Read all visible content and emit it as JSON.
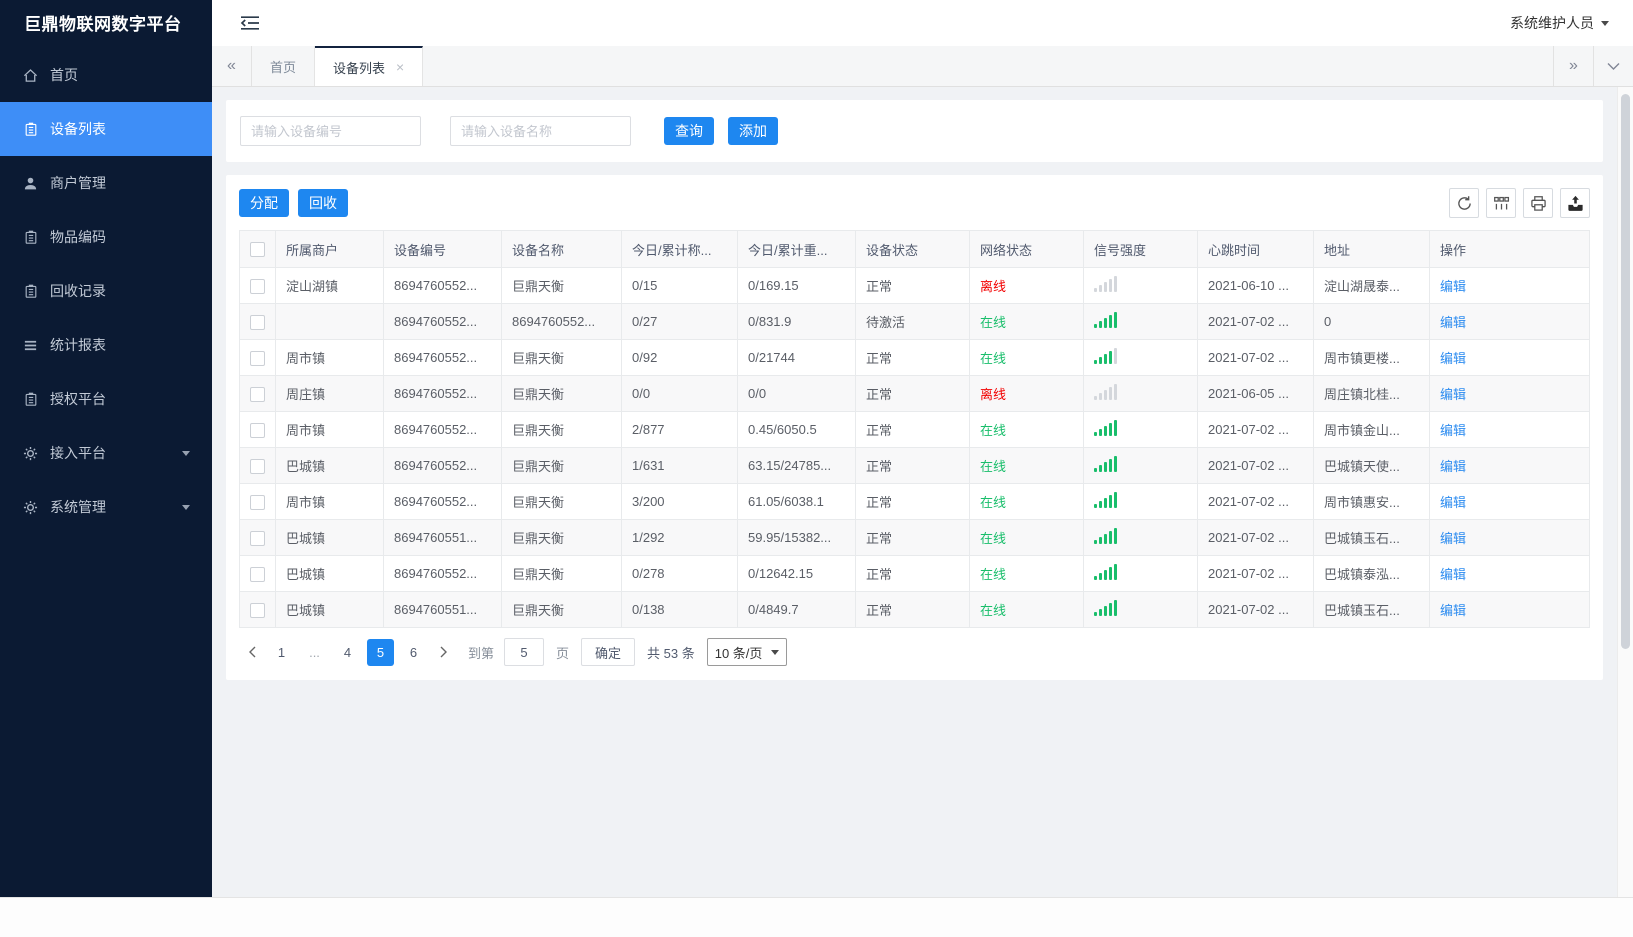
{
  "app": {
    "title": "巨鼎物联网数字平台",
    "user": "系统维护人员"
  },
  "colors": {
    "sidebar_bg": "#0B1A33",
    "sidebar_active": "#3E8EF7",
    "accent": "#1E87F0",
    "success": "#19be6b",
    "danger": "#f20000",
    "link": "#2d8cf0"
  },
  "sidebar": {
    "items": [
      {
        "label": "首页",
        "icon": "home",
        "active": false,
        "arrow": false
      },
      {
        "label": "设备列表",
        "icon": "clipboard",
        "active": true,
        "arrow": false
      },
      {
        "label": "商户管理",
        "icon": "user",
        "active": false,
        "arrow": false
      },
      {
        "label": "物品编码",
        "icon": "clipboard",
        "active": false,
        "arrow": false
      },
      {
        "label": "回收记录",
        "icon": "clipboard",
        "active": false,
        "arrow": false
      },
      {
        "label": "统计报表",
        "icon": "list",
        "active": false,
        "arrow": false
      },
      {
        "label": "授权平台",
        "icon": "clipboard",
        "active": false,
        "arrow": false
      },
      {
        "label": "接入平台",
        "icon": "gear",
        "active": false,
        "arrow": true
      },
      {
        "label": "系统管理",
        "icon": "gear",
        "active": false,
        "arrow": true
      }
    ]
  },
  "tabs": {
    "items": [
      {
        "label": "首页",
        "active": false,
        "closable": false
      },
      {
        "label": "设备列表",
        "active": true,
        "closable": true
      }
    ]
  },
  "search": {
    "device_no_placeholder": "请输入设备编号",
    "device_name_placeholder": "请输入设备名称",
    "query_label": "查询",
    "add_label": "添加"
  },
  "toolbar": {
    "assign_label": "分配",
    "recycle_label": "回收",
    "tools": [
      {
        "icon": "refresh"
      },
      {
        "icon": "columns"
      },
      {
        "icon": "printer"
      },
      {
        "icon": "export"
      }
    ]
  },
  "table": {
    "edit_label": "编辑",
    "columns": [
      {
        "label": "所属商户"
      },
      {
        "label": "设备编号"
      },
      {
        "label": "设备名称"
      },
      {
        "label": "今日/累计称..."
      },
      {
        "label": "今日/累计重..."
      },
      {
        "label": "设备状态"
      },
      {
        "label": "网络状态"
      },
      {
        "label": "信号强度"
      },
      {
        "label": "心跳时间"
      },
      {
        "label": "地址"
      },
      {
        "label": "操作"
      }
    ],
    "rows": [
      {
        "merchant": "淀山湖镇",
        "device_no": "8694760552...",
        "device_name": "巨鼎天衡",
        "today_count": "0/15",
        "today_weight": "0/169.15",
        "device_status": "正常",
        "network_status": "离线",
        "online": false,
        "signal": 0,
        "heartbeat": "2021-06-10 ...",
        "address": "淀山湖晟泰..."
      },
      {
        "merchant": "",
        "device_no": "8694760552...",
        "device_name": "8694760552...",
        "today_count": "0/27",
        "today_weight": "0/831.9",
        "device_status": "待激活",
        "network_status": "在线",
        "online": true,
        "signal": 5,
        "heartbeat": "2021-07-02 ...",
        "address": "0"
      },
      {
        "merchant": "周市镇",
        "device_no": "8694760552...",
        "device_name": "巨鼎天衡",
        "today_count": "0/92",
        "today_weight": "0/21744",
        "device_status": "正常",
        "network_status": "在线",
        "online": true,
        "signal": 4,
        "heartbeat": "2021-07-02 ...",
        "address": "周市镇更楼..."
      },
      {
        "merchant": "周庄镇",
        "device_no": "8694760552...",
        "device_name": "巨鼎天衡",
        "today_count": "0/0",
        "today_weight": "0/0",
        "device_status": "正常",
        "network_status": "离线",
        "online": false,
        "signal": 0,
        "heartbeat": "2021-06-05 ...",
        "address": "周庄镇北桂..."
      },
      {
        "merchant": "周市镇",
        "device_no": "8694760552...",
        "device_name": "巨鼎天衡",
        "today_count": "2/877",
        "today_weight": "0.45/6050.5",
        "device_status": "正常",
        "network_status": "在线",
        "online": true,
        "signal": 5,
        "heartbeat": "2021-07-02 ...",
        "address": "周市镇金山..."
      },
      {
        "merchant": "巴城镇",
        "device_no": "8694760552...",
        "device_name": "巨鼎天衡",
        "today_count": "1/631",
        "today_weight": "63.15/24785...",
        "device_status": "正常",
        "network_status": "在线",
        "online": true,
        "signal": 5,
        "heartbeat": "2021-07-02 ...",
        "address": "巴城镇天使..."
      },
      {
        "merchant": "周市镇",
        "device_no": "8694760552...",
        "device_name": "巨鼎天衡",
        "today_count": "3/200",
        "today_weight": "61.05/6038.1",
        "device_status": "正常",
        "network_status": "在线",
        "online": true,
        "signal": 5,
        "heartbeat": "2021-07-02 ...",
        "address": "周市镇惠安..."
      },
      {
        "merchant": "巴城镇",
        "device_no": "8694760551...",
        "device_name": "巨鼎天衡",
        "today_count": "1/292",
        "today_weight": "59.95/15382...",
        "device_status": "正常",
        "network_status": "在线",
        "online": true,
        "signal": 5,
        "heartbeat": "2021-07-02 ...",
        "address": "巴城镇玉石..."
      },
      {
        "merchant": "巴城镇",
        "device_no": "8694760552...",
        "device_name": "巨鼎天衡",
        "today_count": "0/278",
        "today_weight": "0/12642.15",
        "device_status": "正常",
        "network_status": "在线",
        "online": true,
        "signal": 5,
        "heartbeat": "2021-07-02 ...",
        "address": "巴城镇泰泓..."
      },
      {
        "merchant": "巴城镇",
        "device_no": "8694760551...",
        "device_name": "巨鼎天衡",
        "today_count": "0/138",
        "today_weight": "0/4849.7",
        "device_status": "正常",
        "network_status": "在线",
        "online": true,
        "signal": 5,
        "heartbeat": "2021-07-02 ...",
        "address": "巴城镇玉石..."
      }
    ]
  },
  "pagination": {
    "pages": [
      "1",
      "...",
      "4",
      "5",
      "6"
    ],
    "active_page": "5",
    "jump_label": "到第",
    "jump_value": "5",
    "page_word": "页",
    "confirm_label": "确定",
    "total_text": "共 53 条",
    "page_size_text": "10 条/页"
  }
}
